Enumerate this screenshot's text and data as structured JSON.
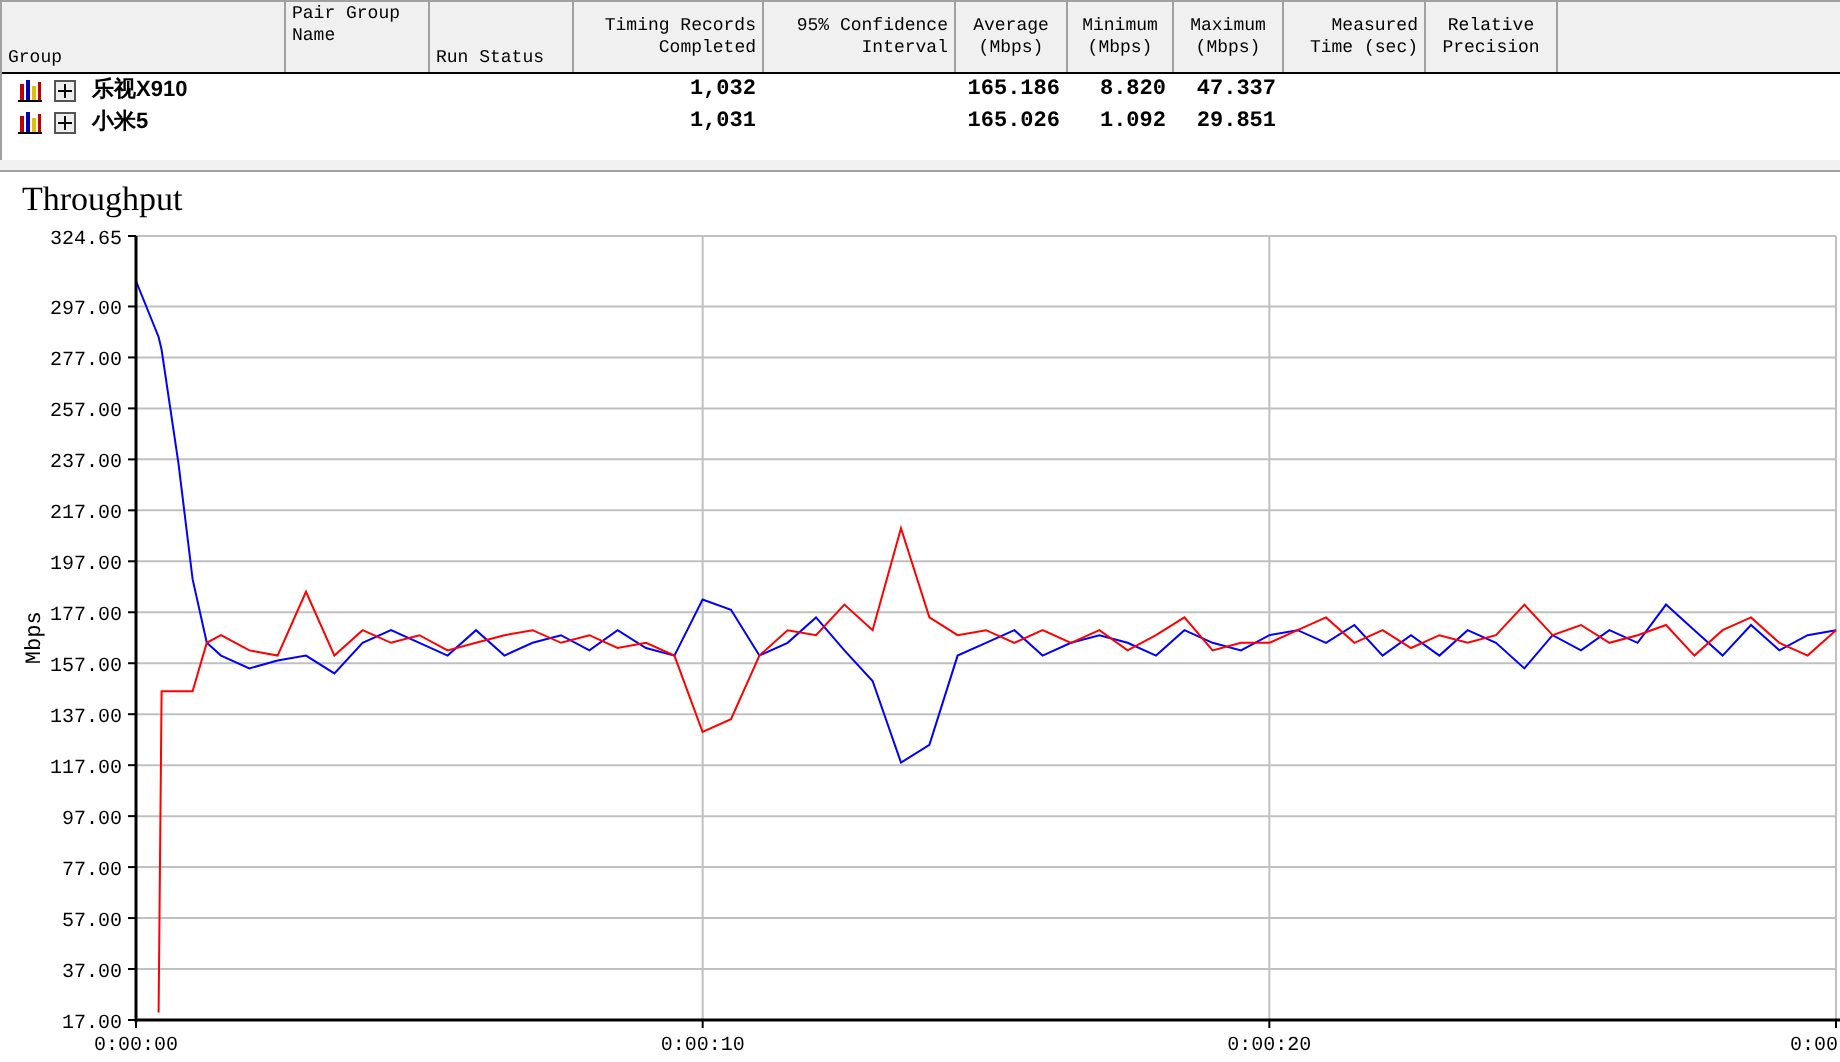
{
  "table": {
    "columns": [
      {
        "header": [
          "Group"
        ]
      },
      {
        "header": [
          "Pair Group",
          "Name"
        ]
      },
      {
        "header": [
          "Run Status"
        ]
      },
      {
        "header": [
          "Timing Records",
          "Completed"
        ]
      },
      {
        "header": [
          "95% Confidence",
          "Interval"
        ]
      },
      {
        "header": [
          "Average",
          "(Mbps)"
        ]
      },
      {
        "header": [
          "Minimum",
          "(Mbps)"
        ]
      },
      {
        "header": [
          "Maximum",
          "(Mbps)"
        ]
      },
      {
        "header": [
          "Measured",
          "Time (sec)"
        ]
      },
      {
        "header": [
          "Relative",
          "Precision"
        ]
      }
    ],
    "rows": [
      {
        "expanded": false,
        "cells": [
          "乐视X910",
          "",
          "",
          "1,032",
          "",
          "165.186",
          "8.820",
          "47.337",
          "",
          ""
        ]
      },
      {
        "expanded": false,
        "cells": [
          "小米5",
          "",
          "",
          "1,031",
          "",
          "165.026",
          "1.092",
          "29.851",
          "",
          ""
        ]
      }
    ]
  },
  "chart": {
    "title": "Throughput",
    "chart_data": {
      "type": "line",
      "grid": true,
      "ylabel": "Mbps",
      "xlim": [
        0,
        30
      ],
      "ylim": [
        17,
        324.65
      ],
      "yticks": [
        {
          "value": 17,
          "label": "17.00"
        },
        {
          "value": 37,
          "label": "37.00"
        },
        {
          "value": 57,
          "label": "57.00"
        },
        {
          "value": 77,
          "label": "77.00"
        },
        {
          "value": 97,
          "label": "97.00"
        },
        {
          "value": 117,
          "label": "117.00"
        },
        {
          "value": 137,
          "label": "137.00"
        },
        {
          "value": 157,
          "label": "157.00"
        },
        {
          "value": 177,
          "label": "177.00"
        },
        {
          "value": 197,
          "label": "197.00"
        },
        {
          "value": 217,
          "label": "217.00"
        },
        {
          "value": 237,
          "label": "237.00"
        },
        {
          "value": 257,
          "label": "257.00"
        },
        {
          "value": 277,
          "label": "277.00"
        },
        {
          "value": 297,
          "label": "297.00"
        },
        {
          "value": 324.65,
          "label": "324.65"
        }
      ],
      "xticks": [
        {
          "value": 0,
          "label": "0:00:00"
        },
        {
          "value": 10,
          "label": "0:00:10"
        },
        {
          "value": 20,
          "label": "0:00:20"
        },
        {
          "value": 30,
          "label": "0:00"
        }
      ],
      "x": [
        0,
        0.4,
        0.45,
        0.75,
        1,
        1.25,
        1.5,
        2,
        2.5,
        3,
        3.5,
        4,
        4.5,
        5,
        5.5,
        6,
        6.5,
        7,
        7.5,
        8,
        8.5,
        9,
        9.5,
        10,
        10.5,
        11,
        11.5,
        12,
        12.5,
        13,
        13.5,
        14,
        14.5,
        15,
        15.5,
        16,
        16.5,
        17,
        17.5,
        18,
        18.5,
        19,
        19.5,
        20,
        20.5,
        21,
        21.5,
        22,
        22.5,
        23,
        23.5,
        24,
        24.5,
        25,
        25.5,
        26,
        26.5,
        27,
        27.5,
        28,
        28.5,
        29,
        29.5,
        30
      ],
      "series": [
        {
          "color": "#0000ff",
          "values": [
            307,
            285,
            280,
            235,
            190,
            165,
            160,
            155,
            158,
            160,
            153,
            165,
            170,
            165,
            160,
            170,
            160,
            165,
            168,
            162,
            170,
            163,
            160,
            182,
            178,
            160,
            165,
            175,
            162,
            150,
            118,
            125,
            160,
            165,
            170,
            160,
            165,
            168,
            165,
            160,
            170,
            165,
            162,
            168,
            170,
            165,
            172,
            160,
            168,
            160,
            170,
            165,
            155,
            168,
            162,
            170,
            165,
            180,
            170,
            160,
            172,
            162,
            168,
            170
          ]
        },
        {
          "color": "#ff0000",
          "values": [
            null,
            20,
            146,
            146,
            146,
            165,
            168,
            162,
            160,
            185,
            160,
            170,
            165,
            168,
            162,
            165,
            168,
            170,
            165,
            168,
            163,
            165,
            160,
            130,
            135,
            160,
            170,
            168,
            180,
            170,
            210,
            175,
            168,
            170,
            165,
            170,
            165,
            170,
            162,
            168,
            175,
            162,
            165,
            165,
            170,
            175,
            165,
            170,
            163,
            168,
            165,
            168,
            180,
            168,
            172,
            165,
            168,
            172,
            160,
            170,
            175,
            165,
            160,
            170
          ]
        }
      ]
    }
  }
}
